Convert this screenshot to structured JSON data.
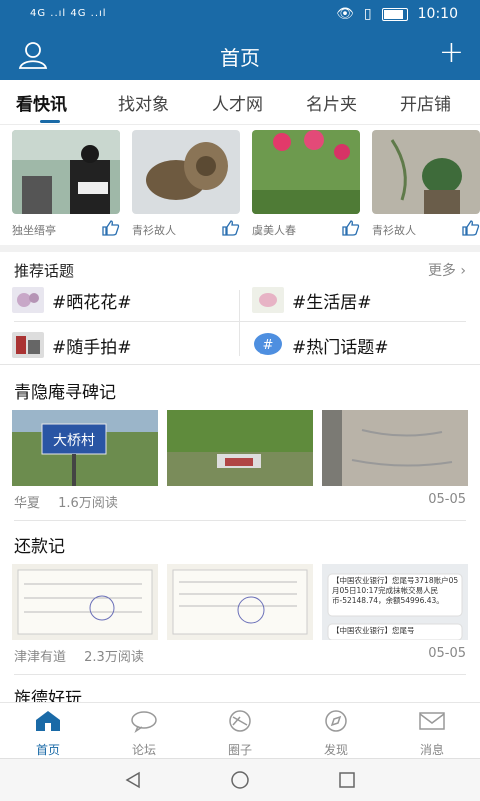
{
  "status_bar": {
    "signal": "4G ..ıl 4G ..ıl",
    "time": "10:10"
  },
  "app_bar": {
    "title": "首页"
  },
  "tabs": [
    {
      "label": "看快讯",
      "active": true
    },
    {
      "label": "找对象"
    },
    {
      "label": "人才网"
    },
    {
      "label": "名片夹"
    },
    {
      "label": "开店铺"
    }
  ],
  "photo_cards": [
    {
      "author": "独坐缙亭"
    },
    {
      "author": "青衫故人"
    },
    {
      "author": "虞美人春"
    },
    {
      "author": "青衫故人"
    }
  ],
  "topics": {
    "title": "推荐话题",
    "more": "更多",
    "items": [
      "#晒花花#",
      "#生活居#",
      "#随手拍#",
      "#热门话题#"
    ]
  },
  "articles": [
    {
      "title": "青隐庵寻碑记",
      "author": "华夏",
      "reads": "1.6万阅读",
      "date": "05-05",
      "sign_text": "大桥村"
    },
    {
      "title": "还款记",
      "author": "津津有道",
      "reads": "2.3万阅读",
      "date": "05-05",
      "sms_text": "【中国农业银行】您尾号3718账户05月05日10:17完成抹帐交易人民币-52148.74，余额54996.43。",
      "sms_text2": "【中国农业银行】您尾号"
    },
    {
      "title": "旌德好玩"
    }
  ],
  "bottom_nav": [
    {
      "label": "首页",
      "icon": "home-icon",
      "active": true
    },
    {
      "label": "论坛",
      "icon": "chat-bubble-icon"
    },
    {
      "label": "圈子",
      "icon": "circle-icon"
    },
    {
      "label": "发现",
      "icon": "compass-icon"
    },
    {
      "label": "消息",
      "icon": "mail-icon"
    }
  ],
  "colors": {
    "primary": "#1a6aa7",
    "text": "#222222",
    "muted": "#888888"
  }
}
